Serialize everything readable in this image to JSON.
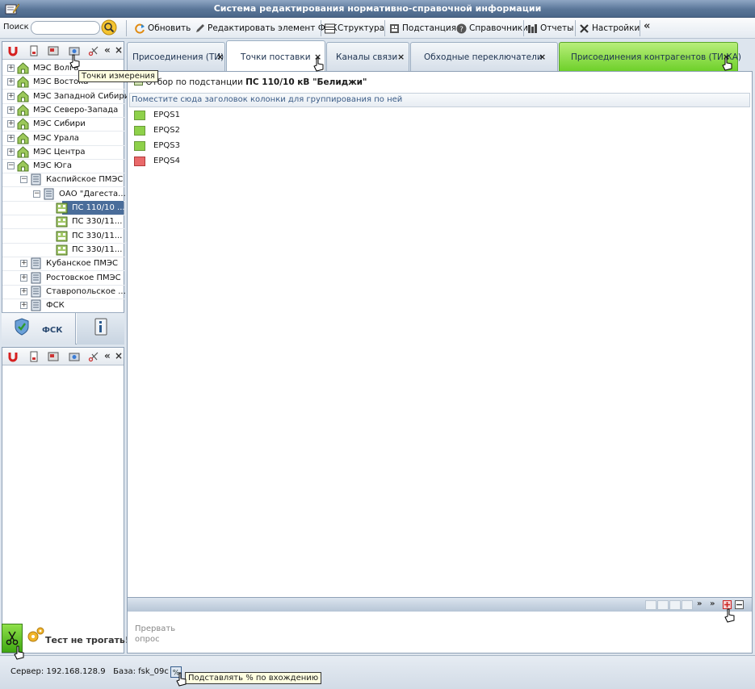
{
  "app": {
    "title": "Система редактирования нормативно-справочной информации"
  },
  "toolbar": {
    "search_label": "Поиск",
    "search_value": "",
    "refresh_label": "Обновить",
    "edit_fsk_label": "Редактировать элемент ФСК",
    "structure_label": "Структура",
    "substation_label": "Подстанция",
    "references_label": "Справочники",
    "reports_label": "Отчеты",
    "settings_label": "Настройки",
    "collapse_label": "«"
  },
  "left_panel": {
    "collapse_label": "«",
    "close_label": "×",
    "tooltip": "Точки измерения",
    "tree": [
      {
        "label": "МЭС Волга"
      },
      {
        "label": "МЭС Востока"
      },
      {
        "label": "МЭС Западной Сибири"
      },
      {
        "label": "МЭС Северо-Запада"
      },
      {
        "label": "МЭС Сибири"
      },
      {
        "label": "МЭС Урала"
      },
      {
        "label": "МЭС Центра"
      },
      {
        "label": "МЭС Юга"
      },
      {
        "label": "Каспийское ПМЭС"
      },
      {
        "label": "ОАО \"Дагеста..."
      },
      {
        "label": "ПС 110/10 ..."
      },
      {
        "label": "ПС 330/11..."
      },
      {
        "label": "ПС 330/11..."
      },
      {
        "label": "ПС 330/11..."
      },
      {
        "label": "Кубанское ПМЭС"
      },
      {
        "label": "Ростовское ПМЭС"
      },
      {
        "label": "Ставропольское ..."
      },
      {
        "label": "ФСК"
      }
    ],
    "tab_fsk_label": "ФСК",
    "test_label": "Тест не трогать!"
  },
  "tabs": [
    {
      "label": "Присоединения (ТИ)",
      "close": "×"
    },
    {
      "label": "Точки поставки",
      "close": "×"
    },
    {
      "label": "Каналы связи",
      "close": "×"
    },
    {
      "label": "Обходные переключатели",
      "close": "×"
    },
    {
      "label": "Присоединения контрагентов (ТИ КА)",
      "close": "×"
    }
  ],
  "content": {
    "filter_prefix": "Отбор по подстанции ",
    "filter_value": "ПС 110/10 кВ \"Белиджи\"",
    "group_hint": "Поместите сюда заголовок колонки для группирования по ней",
    "rows": [
      {
        "name": "EPQS1",
        "status_color": "#8ed14a"
      },
      {
        "name": "EPQS2",
        "status_color": "#8ed14a"
      },
      {
        "name": "EPQS3",
        "status_color": "#8ed14a"
      },
      {
        "name": "EPQS4",
        "status_color": "#e9696a"
      }
    ],
    "pager_next": "»",
    "pager_last": "»",
    "abort_label": "Прервать опрос"
  },
  "status": {
    "server_label": "Сервер: 192.168.128.9",
    "db_label": "База: fsk_09c",
    "separator": "|",
    "tooltip": "Подставлять % по вхождению"
  }
}
